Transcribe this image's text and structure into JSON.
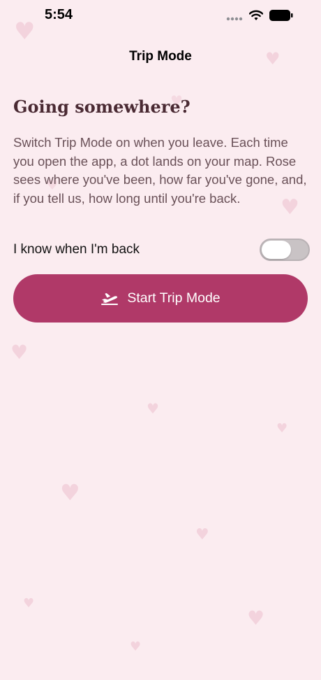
{
  "status_bar": {
    "time": "5:54"
  },
  "nav": {
    "title": "Trip Mode"
  },
  "content": {
    "headline": "Going somewhere?",
    "description": "Switch Trip Mode on when you leave. Each time you open the app, a dot lands on your map. Rose sees where you've been, how far you've gone, and, if you tell us, how long until you're back.",
    "toggle_label": "I know when I'm back",
    "toggle_on": false,
    "start_button_label": "Start Trip Mode",
    "start_button_icon": "airplane-takeoff-icon"
  },
  "colors": {
    "background": "#fbecf0",
    "accent": "#b03968",
    "headline": "#4a2a33",
    "body_text": "#6a5158"
  }
}
